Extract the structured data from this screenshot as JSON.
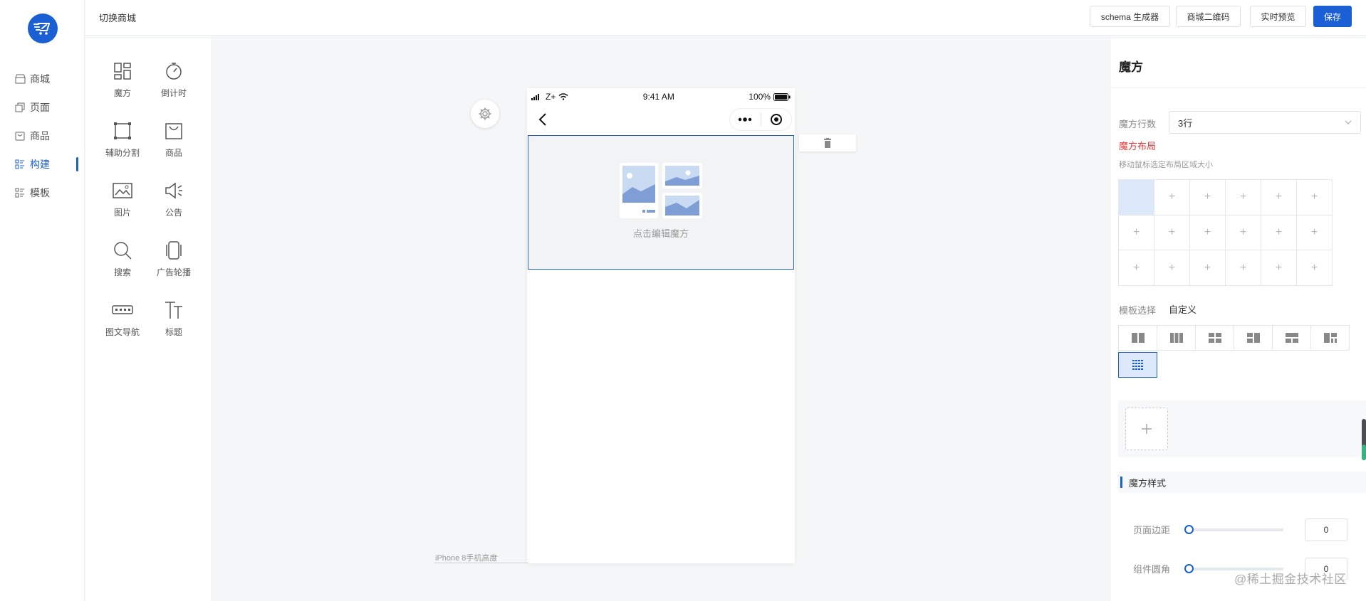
{
  "sidebar": {
    "items": [
      {
        "label": "商城",
        "icon": "store-icon"
      },
      {
        "label": "页面",
        "icon": "pages-icon"
      },
      {
        "label": "商品",
        "icon": "goods-icon"
      },
      {
        "label": "构建",
        "icon": "build-icon",
        "active": true
      },
      {
        "label": "模板",
        "icon": "template-icon"
      }
    ]
  },
  "topbar": {
    "shop_switch": "切换商城",
    "schema_btn": "schema 生成器",
    "qrcode_btn": "商城二维码",
    "preview_btn": "实时预览",
    "save_btn": "保存"
  },
  "components": [
    {
      "label": "魔方",
      "icon": "magic-cube-icon"
    },
    {
      "label": "倒计时",
      "icon": "stopwatch-icon"
    },
    {
      "label": "辅助分割",
      "icon": "divider-icon"
    },
    {
      "label": "商品",
      "icon": "shopping-bag-icon"
    },
    {
      "label": "图片",
      "icon": "image-icon"
    },
    {
      "label": "公告",
      "icon": "megaphone-icon"
    },
    {
      "label": "搜索",
      "icon": "search-icon"
    },
    {
      "label": "广告轮播",
      "icon": "carousel-icon"
    },
    {
      "label": "图文导航",
      "icon": "nav-grid-icon"
    },
    {
      "label": "标题",
      "icon": "title-icon"
    }
  ],
  "phone": {
    "carrier": "Z+",
    "time": "9:41 AM",
    "battery": "100%",
    "cube_hint": "点击编辑魔方",
    "device_label": "iPhone 8手机高度"
  },
  "panel": {
    "title": "魔方",
    "rows_label": "魔方行数",
    "rows_value": "3行",
    "layout_title": "魔方布局",
    "layout_hint": "移动鼠标选定布局区域大小",
    "grid_cells": [
      "",
      "+",
      "+",
      "+",
      "+",
      "+",
      "+",
      "+",
      "+",
      "+",
      "+",
      "+",
      "+",
      "+",
      "+",
      "+",
      "+",
      "+"
    ],
    "template_label": "模板选择",
    "template_value": "自定义",
    "style_section": "魔方样式",
    "page_margin_label": "页面边距",
    "page_margin_value": "0",
    "corner_label": "组件圆角",
    "corner_value": "0"
  },
  "watermark": "@稀土掘金技术社区",
  "colors": {
    "accent": "#1a5fd4",
    "danger": "#e53935"
  }
}
